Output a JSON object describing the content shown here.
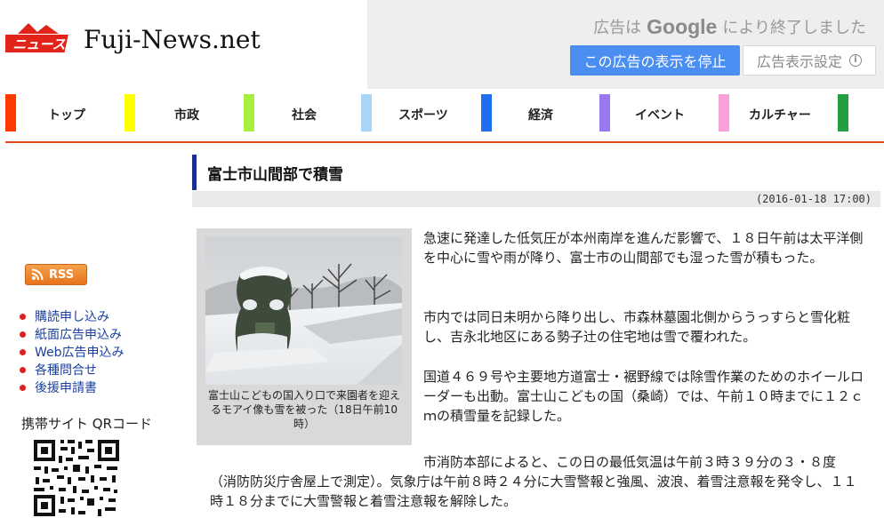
{
  "site": {
    "name": "Fuji-News.net",
    "logo_text": "ニュース"
  },
  "ad": {
    "ended_prefix": "広告は",
    "ended_brand": "Google",
    "ended_suffix": "により終了しました",
    "stop_label": "この広告の表示を停止",
    "settings_label": "広告表示設定",
    "settings_icon": "info-icon"
  },
  "nav": {
    "items": [
      {
        "label": "トップ",
        "color": "#ff3a00"
      },
      {
        "label": "市政",
        "color": "#ffff00"
      },
      {
        "label": "社会",
        "color": "#a8f040"
      },
      {
        "label": "スポーツ",
        "color": "#a8d4f8"
      },
      {
        "label": "経済",
        "color": "#1f6ef0"
      },
      {
        "label": "イベント",
        "color": "#9a78f0"
      },
      {
        "label": "カルチャー",
        "color": "#f8a0d8"
      },
      {
        "label": "",
        "color": "#20a040"
      }
    ],
    "rule_color": "#e24a1b"
  },
  "sidebar": {
    "rss_label": "RSS",
    "links": [
      "購読申し込み",
      "紙面広告申込み",
      "Web広告申込み",
      "各種問合せ",
      "後援申請書"
    ],
    "mobile_title": "携帯サイト QRコード"
  },
  "article": {
    "title": "富士市山間部で積雪",
    "date": "(2016-01-18 17:00)",
    "photo_caption": "富士山こどもの国入り口で来園者を迎えるモアイ像も雪を被った（18日午前10時）",
    "paragraphs": [
      "急速に発達した低気圧が本州南岸を進んだ影響で、１８日午前は太平洋側を中心に雪や雨が降り、富士市の山間部でも湿った雪が積もった。",
      "市内では同日未明から降り出し、市森林墓園北側からうっすらと雪化粧し、吉永北地区にある勢子辻の住宅地は雪で覆われた。",
      "国道４６９号や主要地方道富士・裾野線では除雪作業のためのホイールローダーも出動。富士山こどもの国（桑崎）では、午前１０時までに１２ｃｍの積雪量を記録した。",
      "市消防本部によると、この日の最低気温は午前３時３９分の３・８度",
      "（消防防災庁舎屋上で測定）。気象庁は午前８時２４分に大雪警報と強風、波浪、着雪注意報を発令し、１１時１８分までに大雪警報と着雪注意報を解除した。"
    ]
  }
}
